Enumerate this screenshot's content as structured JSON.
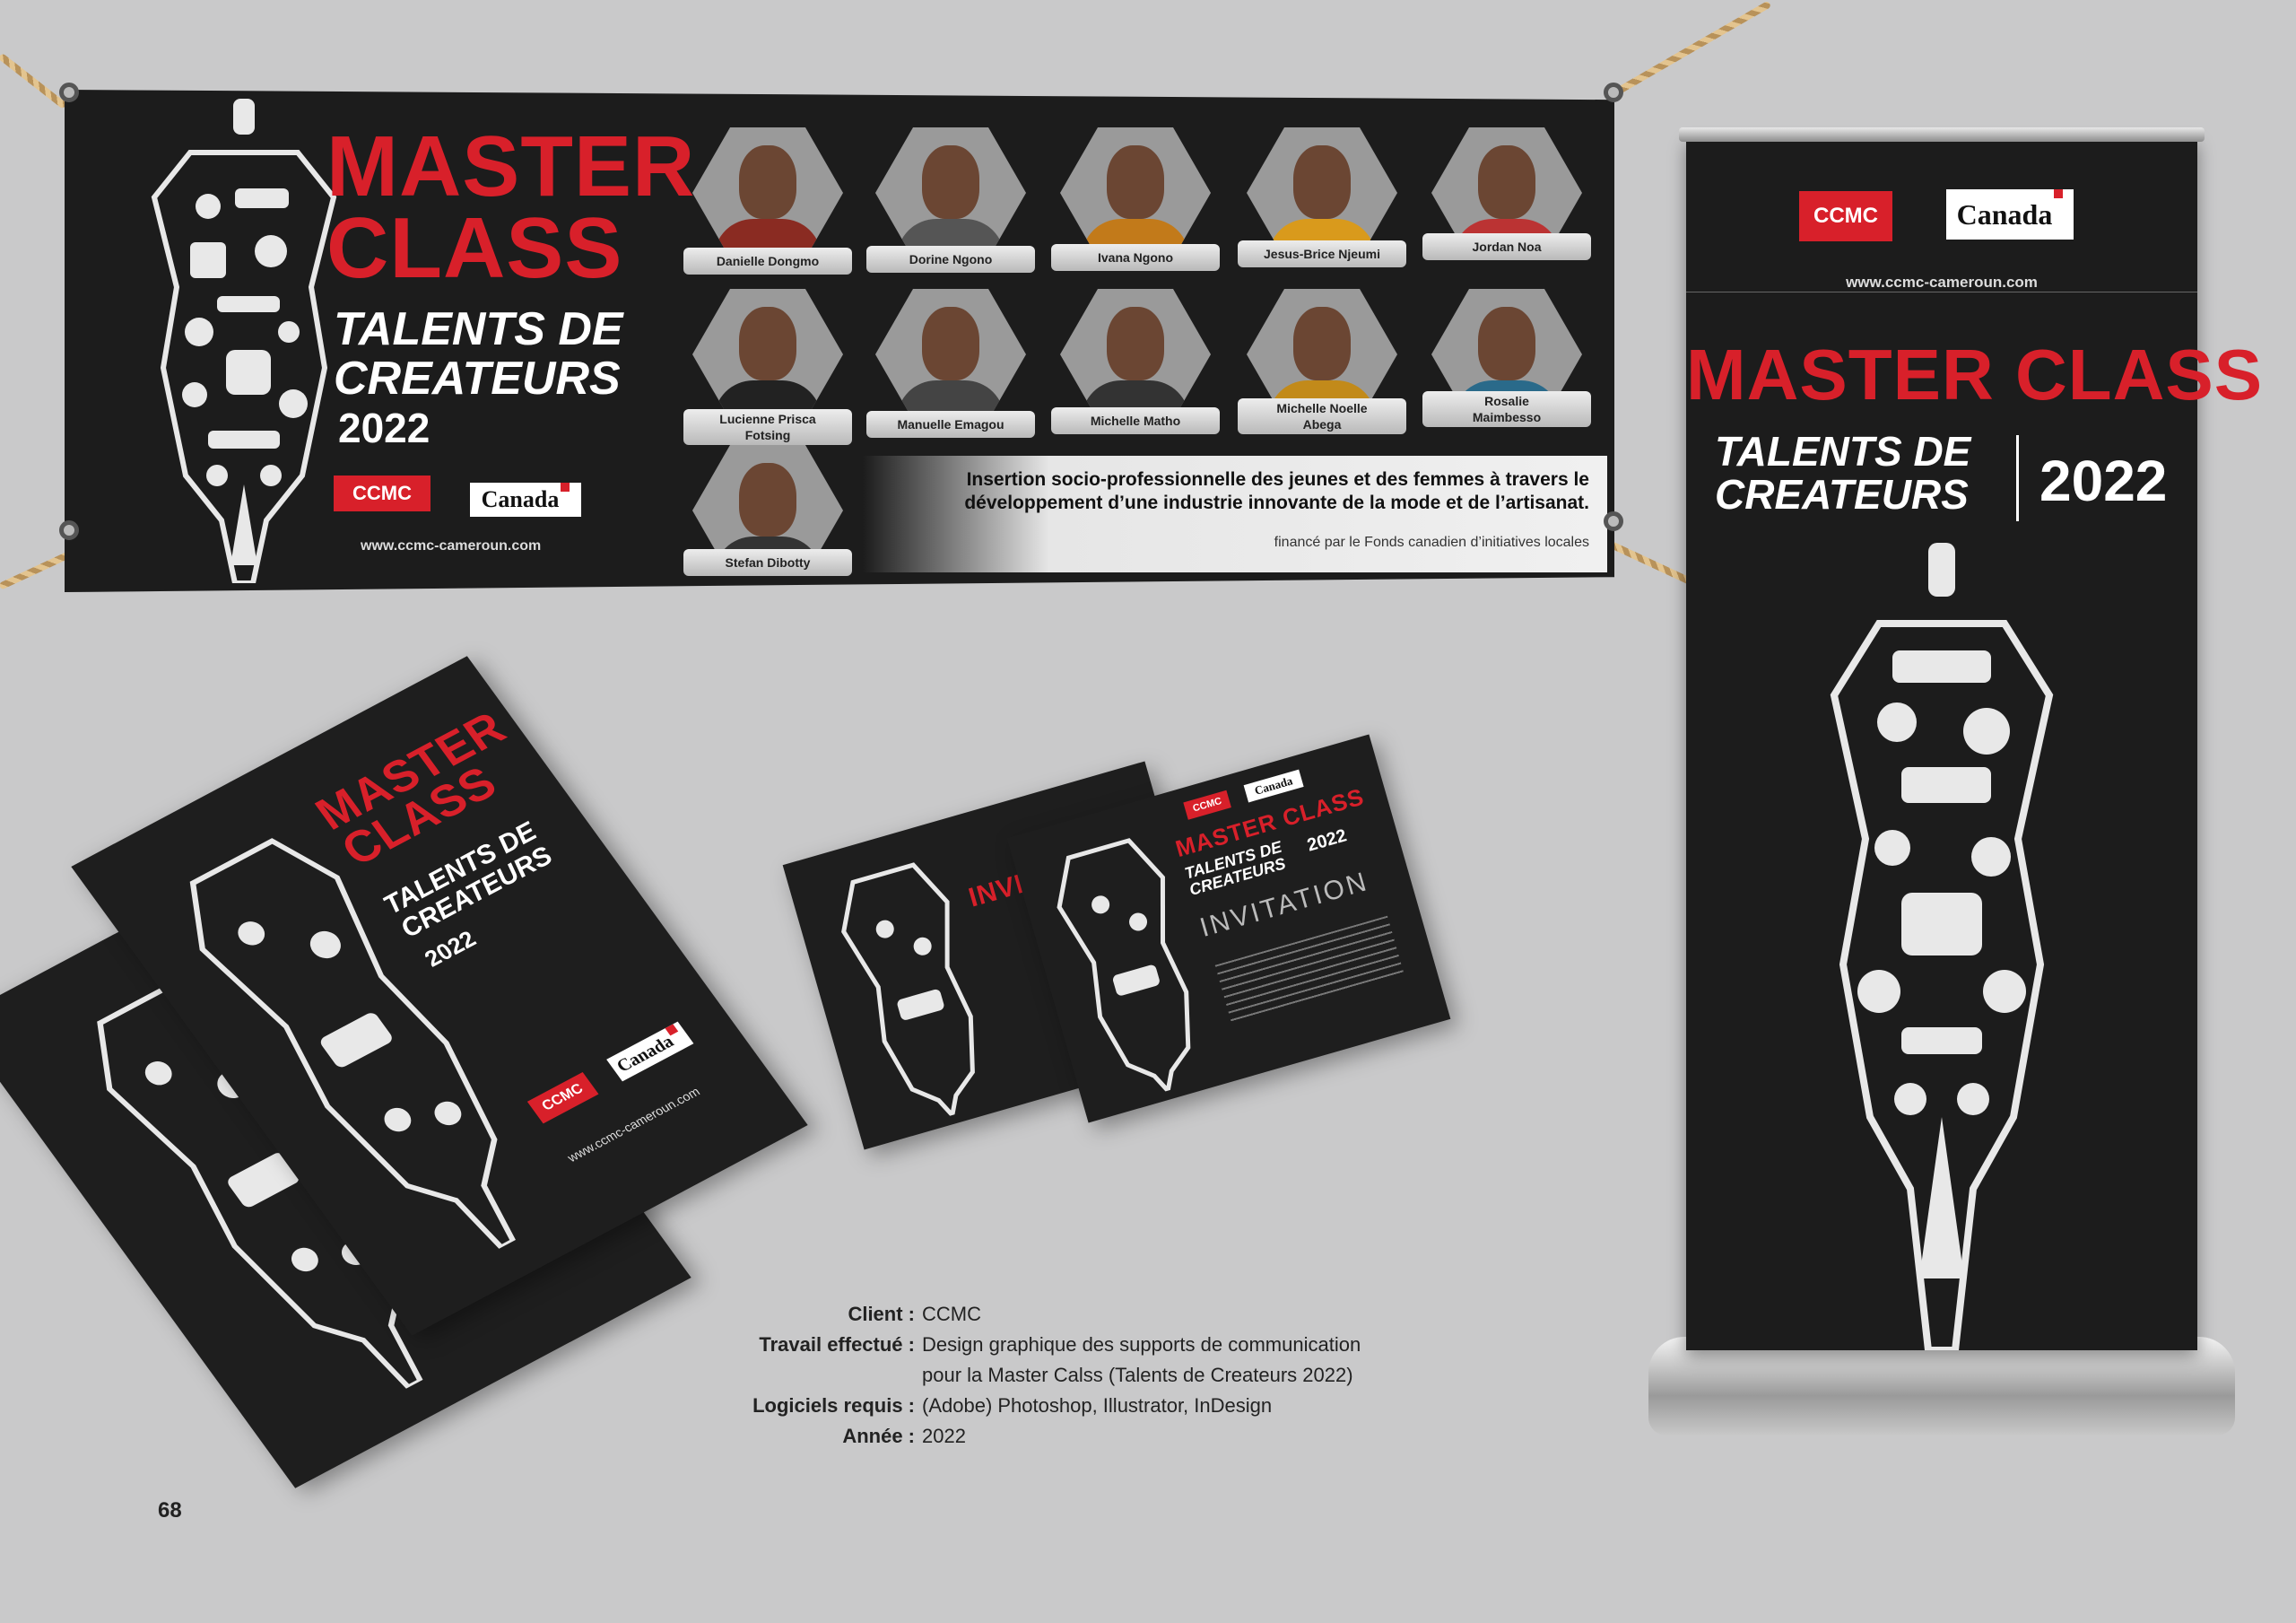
{
  "banner": {
    "title_line1": "MASTER",
    "title_line2": "CLASS",
    "subtitle_line1": "TALENTS DE",
    "subtitle_line2": "CREATEURS",
    "year": "2022",
    "logo_ccmc": "CCMC",
    "logo_canada": "Canada",
    "website": "www.ccmc-cameroun.com",
    "tagline_line1": "Insertion socio-professionnelle des jeunes et des femmes à travers le",
    "tagline_line2": "développement d’une industrie innovante de la mode et de l’artisanat.",
    "funding": "financé par le Fonds canadien d’initiatives locales",
    "participants": [
      {
        "name": "Danielle Dongmo"
      },
      {
        "name": "Dorine Ngono"
      },
      {
        "name": "Ivana Ngono"
      },
      {
        "name": "Jesus-Brice Njeumi"
      },
      {
        "name": "Jordan Noa"
      },
      {
        "name": "Lucienne Prisca",
        "name2": "Fotsing"
      },
      {
        "name": "Manuelle Emagou"
      },
      {
        "name": "Michelle Matho"
      },
      {
        "name": "Michelle Noelle",
        "name2": "Abega"
      },
      {
        "name": "Rosalie",
        "name2": "Maimbesso"
      },
      {
        "name": "Stefan Dibotty"
      }
    ]
  },
  "rollup": {
    "logo_ccmc": "CCMC",
    "logo_canada": "Canada",
    "website": "www.ccmc-cameroun.com",
    "title": "MASTER CLASS",
    "subtitle_line1": "TALENTS DE",
    "subtitle_line2": "CREATEURS",
    "year": "2022"
  },
  "flyers": {
    "title_line1": "MASTER",
    "title_line2": "CLASS",
    "subtitle_line1": "TALENTS DE",
    "subtitle_line2": "CREATEURS",
    "year": "2022",
    "logo_ccmc": "CCMC",
    "logo_canada": "Canada",
    "website": "www.ccmc-cameroun.com"
  },
  "invitation": {
    "title": "MASTER CLASS",
    "subtitle_line1": "TALENTS DE",
    "subtitle_line2": "CREATEURS",
    "year": "2022",
    "invitation_label": "INVITATION",
    "back_partial": "INVI",
    "logo_ccmc": "CCMC",
    "logo_canada": "Canada"
  },
  "caption": {
    "client_label": "Client :",
    "client_value": "CCMC",
    "work_label": "Travail effectué :",
    "work_value_line1": "Design graphique des supports de communication",
    "work_value_line2": "pour la Master Calss (Talents de Createurs 2022)",
    "software_label": "Logiciels requis :",
    "software_value": "(Adobe) Photoshop, Illustrator, InDesign",
    "year_label": "Année :",
    "year_value": "2022"
  },
  "page_number": "68",
  "colors": {
    "brand_red": "#d8202a",
    "panel_dark": "#1c1c1c",
    "background": "#c9c9ca"
  }
}
